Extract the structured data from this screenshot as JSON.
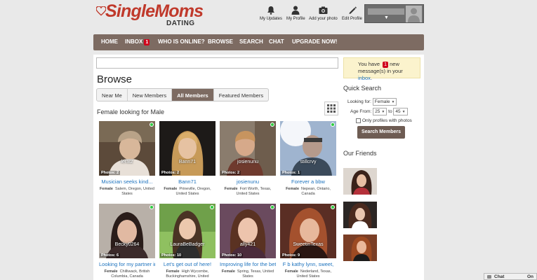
{
  "brand": {
    "name": "SingleMoms",
    "tagline": "DATING",
    "color": "#c0392b"
  },
  "header_icons": [
    {
      "label": "My Updates",
      "icon": "bell-icon"
    },
    {
      "label": "My Profile",
      "icon": "user-icon"
    },
    {
      "label": "Add your photo",
      "icon": "camera-icon"
    },
    {
      "label": "Edit Profile",
      "icon": "pencil-icon"
    }
  ],
  "nav": [
    {
      "label": "HOME"
    },
    {
      "label": "INBOX",
      "badge": "1"
    },
    {
      "label": "WHO IS ONLINE?"
    },
    {
      "label": "BROWSE"
    },
    {
      "label": "SEARCH"
    },
    {
      "label": "CHAT"
    },
    {
      "label": "UPGRADE NOW!"
    }
  ],
  "page": {
    "title": "Browse",
    "tabs": [
      "Near Me",
      "New Members",
      "All Members",
      "Featured Members"
    ],
    "active_tab": "All Members",
    "section_label": "Female looking for Male"
  },
  "members": [
    {
      "username": "leratz",
      "photos": "Photos: 2",
      "tagline": "Musician seeks kind...",
      "gender": "Female",
      "location": "Salem, Oregon, United States",
      "online": true
    },
    {
      "username": "Bann71",
      "photos": "Photos: 2",
      "tagline": "Bann71",
      "gender": "Female",
      "location": "Prineville, Oregon, United States",
      "online": false
    },
    {
      "username": "josienunu",
      "photos": "Photos: 2",
      "tagline": "josienunu",
      "gender": "Female",
      "location": "Fort Worth, Texas, United States",
      "online": true
    },
    {
      "username": "stillcrvy",
      "photos": "Photos: 1",
      "tagline": "Forever a bbw",
      "gender": "Female",
      "location": "Nepean, Ontario, Canada",
      "online": true
    },
    {
      "username": "Becky0264",
      "photos": "Photos: 6",
      "tagline": "Looking for my partner in..",
      "gender": "Female",
      "location": "Chilliwack, British Columbia, Canada",
      "online": true
    },
    {
      "username": "LauraBeBadger",
      "photos": "Photos: 10",
      "tagline": "Let's get out of here!",
      "gender": "Female",
      "location": "High Wycombe, Buckinghamshire, United",
      "online": true
    },
    {
      "username": "ally421",
      "photos": "Photos: 10",
      "tagline": "Improving life for the better",
      "gender": "Female",
      "location": "Spring, Texas, United States",
      "online": true
    },
    {
      "username": "SweetinTexas",
      "photos": "Photos: 9",
      "tagline": "F b kathy lynn, sweet,",
      "gender": "Female",
      "location": "Nederland, Texas, United States",
      "online": true
    }
  ],
  "messages": {
    "prefix": "You have",
    "count": "1",
    "middle": "new",
    "line2": "message(s) in your",
    "link": "inbox",
    "suffix": "."
  },
  "quick_search": {
    "title": "Quick Search",
    "looking_for_label": "Looking for:",
    "looking_for_value": "Female",
    "age_from_label": "Age From:",
    "age_from": "25",
    "to_label": "to",
    "age_to": "45",
    "photos_only_label": "Only profiles with photos",
    "button": "Search Members"
  },
  "friends": {
    "title": "Our Friends"
  },
  "chat": {
    "label": "Chat",
    "status": "On"
  }
}
